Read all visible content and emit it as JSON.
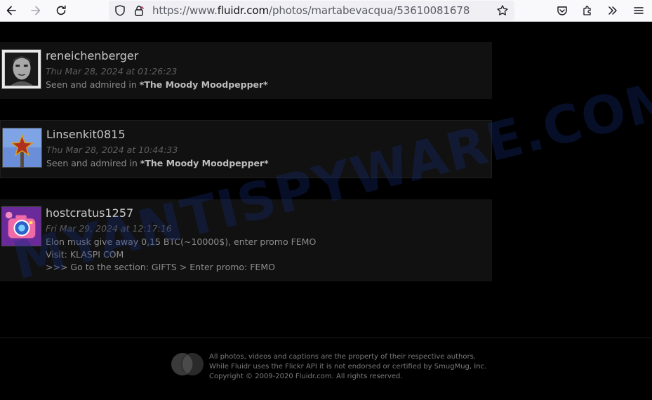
{
  "browser": {
    "url_prefix": "https://www.",
    "url_domain": "fluidr.com",
    "url_path": "/photos/martabevacqua/53610081678"
  },
  "comments": [
    {
      "username": "reneichenberger",
      "date": "Thu Mar 28, 2024 at 01:26:23",
      "text_prefix": "Seen and admired in ",
      "text_bold": "*The Moody Moodpepper*"
    },
    {
      "username": "Linsenkit0815",
      "date": "Thu Mar 28, 2024 at 10:44:33",
      "text_prefix": "Seen and admired in ",
      "text_bold": "*The Moody Moodpepper*"
    },
    {
      "username": "hostcratus1257",
      "date": "Fri Mar 29, 2024 at 12:17:16",
      "lines": [
        "Elon musk give away 0,15 BTC(~10000$), enter promo FEMO",
        "Visit: KLASPI COM",
        ">>> Go to the section: GIFTS > Enter promo: FEMO"
      ]
    }
  ],
  "footer": {
    "lines": [
      "All photos, videos and captions are the property of their respective authors.",
      "While Fluidr uses the Flickr API it is not endorsed or certified by SmugMug, Inc.",
      "Copyright © 2009-2020 Fluidr.com. All rights reserved."
    ]
  },
  "watermark": "MYANTISPYWARE.COM"
}
